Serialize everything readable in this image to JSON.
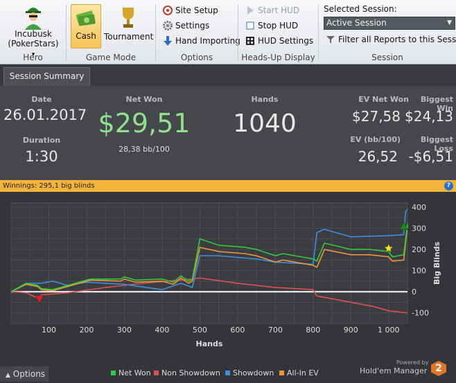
{
  "ribbon": {
    "hero": {
      "name": "Incubusk",
      "site": "(PokerStars)",
      "caret": "▾",
      "caption": "Hero"
    },
    "game_mode": {
      "cash": "Cash",
      "tournament": "Tournament",
      "caption": "Game Mode"
    },
    "options": {
      "site_setup": "Site Setup",
      "settings": "Settings",
      "hand_importing": "Hand Importing",
      "caption": "Options"
    },
    "hud": {
      "start": "Start HUD",
      "stop": "Stop HUD",
      "settings": "HUD Settings",
      "caption": "Heads-Up Display"
    },
    "session": {
      "label": "Selected Session:",
      "selected": "Active Session",
      "filter": "Filter all Reports to this Session",
      "caption": "Session"
    }
  },
  "tab": {
    "label": "Session Summary"
  },
  "summary": {
    "date_label": "Date",
    "date": "26.01.2017",
    "duration_label": "Duration",
    "duration": "1:30",
    "netwon_label": "Net Won",
    "netwon": "$29,51",
    "bb100": "28,38 bb/100",
    "hands_label": "Hands",
    "hands": "1040",
    "ev_label": "EV Net Won",
    "ev": "$27,58",
    "evbb_label": "EV (bb/100)",
    "evbb": "26,52",
    "bigwin_label": "Biggest Win",
    "bigwin": "$24,13",
    "bigloss_label": "Biggest Loss",
    "bigloss": "-$6,51"
  },
  "winnings": "Winnings: 295,1 big blinds",
  "help": "?",
  "footer": {
    "options": "Options",
    "powered": "Powered by",
    "brand": "Hold'em Manager",
    "brand_num": "2"
  },
  "colors": {
    "net_won": "#2ecc40",
    "non_showdown": "#e05050",
    "showdown": "#3a8fe0",
    "allin_ev": "#f0963a",
    "accent": "#f3b43c"
  },
  "chart_data": {
    "type": "line",
    "xlabel": "Hands",
    "ylabel": "Big Blinds",
    "xlim": [
      0,
      1050
    ],
    "ylim": [
      -150,
      420
    ],
    "xticks": [
      100,
      200,
      300,
      400,
      500,
      600,
      700,
      800,
      900,
      1000
    ],
    "yticks": [
      -100,
      0,
      100,
      200,
      300,
      400
    ],
    "grid": true,
    "legend_position": "bottom",
    "series": [
      {
        "name": "Net Won",
        "x": [
          0,
          40,
          70,
          80,
          110,
          200,
          210,
          290,
          300,
          330,
          400,
          430,
          450,
          470,
          480,
          500,
          550,
          620,
          650,
          700,
          720,
          800,
          810,
          830,
          900,
          950,
          1000,
          1010,
          1040,
          1050
        ],
        "y": [
          0,
          40,
          30,
          15,
          10,
          55,
          60,
          60,
          70,
          55,
          60,
          45,
          75,
          50,
          60,
          250,
          220,
          210,
          200,
          170,
          180,
          155,
          145,
          230,
          200,
          200,
          190,
          165,
          175,
          320
        ]
      },
      {
        "name": "Non Showdown",
        "x": [
          0,
          40,
          70,
          80,
          150,
          250,
          350,
          480,
          500,
          600,
          700,
          800,
          810,
          900,
          960,
          1000,
          1050
        ],
        "y": [
          0,
          -5,
          -30,
          -15,
          -5,
          20,
          40,
          60,
          65,
          40,
          20,
          10,
          -20,
          -50,
          -70,
          -90,
          -100
        ]
      },
      {
        "name": "Showdown",
        "x": [
          0,
          40,
          80,
          110,
          150,
          200,
          300,
          400,
          450,
          480,
          500,
          550,
          650,
          700,
          800,
          810,
          830,
          900,
          1000,
          1040,
          1045,
          1050
        ],
        "y": [
          0,
          40,
          40,
          50,
          30,
          45,
          35,
          10,
          40,
          20,
          170,
          170,
          155,
          140,
          130,
          280,
          295,
          260,
          265,
          270,
          380,
          390
        ]
      },
      {
        "name": "All-In EV",
        "x": [
          0,
          40,
          70,
          80,
          110,
          200,
          210,
          290,
          300,
          330,
          400,
          430,
          450,
          470,
          480,
          500,
          550,
          620,
          650,
          700,
          720,
          800,
          810,
          830,
          900,
          950,
          1000,
          1010,
          1040,
          1050
        ],
        "y": [
          0,
          35,
          25,
          10,
          5,
          50,
          55,
          50,
          60,
          45,
          50,
          35,
          65,
          40,
          50,
          210,
          190,
          180,
          170,
          140,
          150,
          125,
          115,
          200,
          175,
          175,
          165,
          145,
          150,
          310
        ]
      }
    ],
    "markers": [
      {
        "type": "star",
        "series": "Net Won",
        "x": 1000,
        "y": 205,
        "color": "#f4e020"
      },
      {
        "type": "triangle-down",
        "x": 75,
        "y": -35,
        "color": "#e02020"
      },
      {
        "type": "triangle-up",
        "x": 1040,
        "y": 310,
        "color": "#1a8a1a"
      }
    ]
  }
}
